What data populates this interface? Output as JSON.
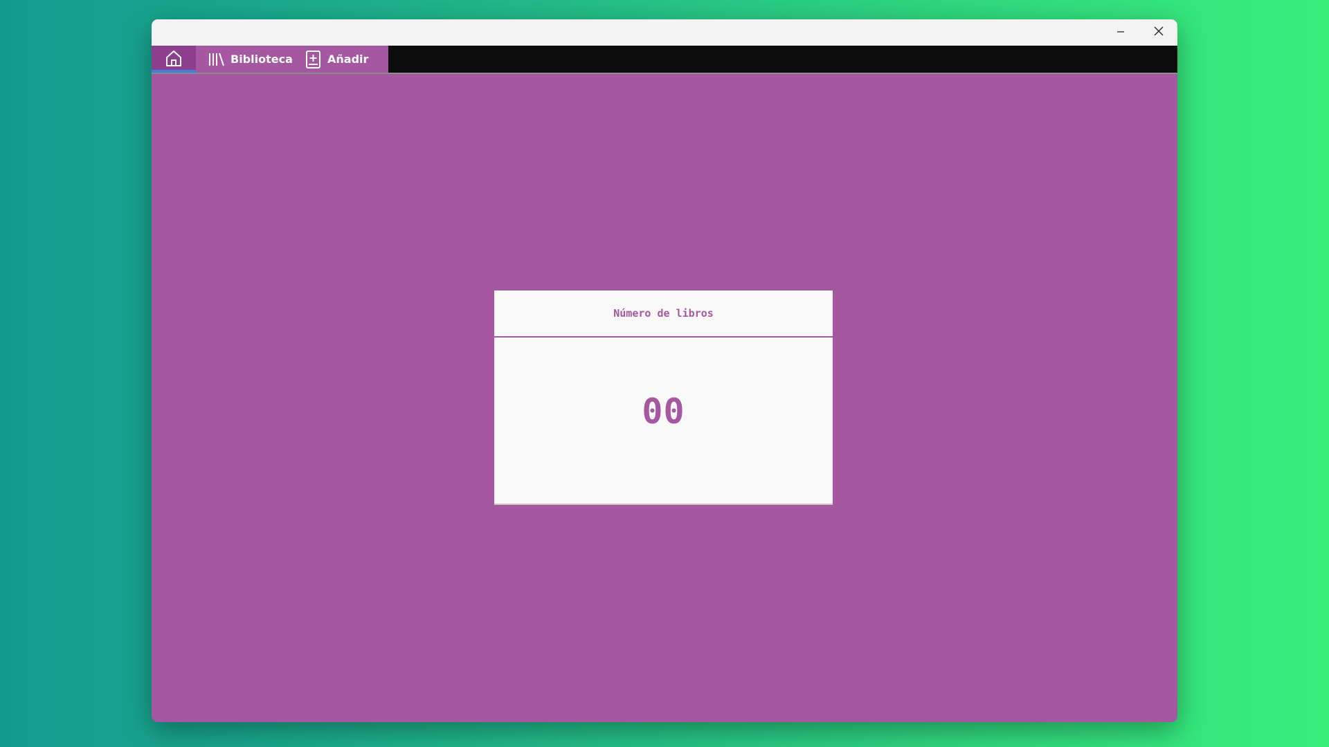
{
  "window": {
    "controls": {
      "minimize_icon": "minimize-icon",
      "close_icon": "close-icon"
    }
  },
  "nav": {
    "home_icon": "home-icon",
    "items": [
      {
        "label": "Biblioteca",
        "icon": "library-icon"
      },
      {
        "label": "Añadir",
        "icon": "add-book-icon"
      }
    ]
  },
  "card": {
    "title": "Número de libros",
    "value": "00"
  },
  "colors": {
    "accent": "#a657a2",
    "nav_active": "#8c3f8c",
    "nav_bar": "#0c0c0c",
    "indicator": "#3f7fd6",
    "card_bg": "#faf9fa"
  }
}
